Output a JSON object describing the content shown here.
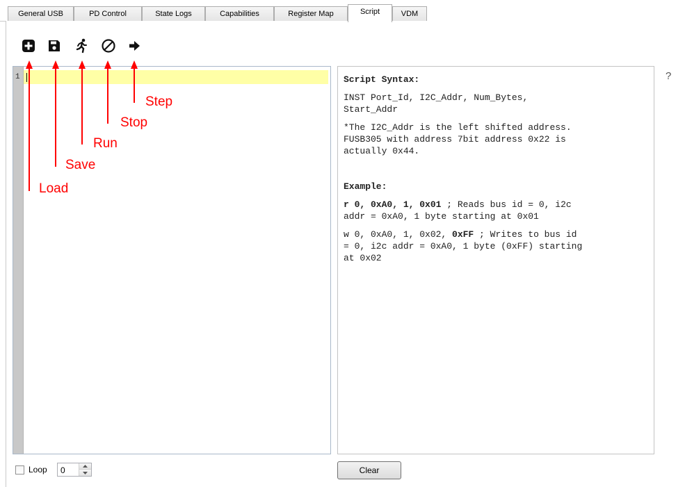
{
  "tabs": [
    {
      "label": "General USB",
      "active": false
    },
    {
      "label": "PD Control",
      "active": false
    },
    {
      "label": "State Logs",
      "active": false
    },
    {
      "label": "Capabilities",
      "active": false
    },
    {
      "label": "Register Map",
      "active": false
    },
    {
      "label": "Script",
      "active": true
    },
    {
      "label": "VDM",
      "active": false
    }
  ],
  "toolbar": {
    "icons": [
      "load-plus-icon",
      "save-floppy-icon",
      "run-figure-icon",
      "stop-circle-icon",
      "step-arrow-icon"
    ]
  },
  "editor": {
    "line_number": "1",
    "highlight_color": "#ffffa6"
  },
  "help": {
    "title": "Script Syntax:",
    "syntax": "INST Port_Id, I2C_Addr, Num_Bytes,\nStart_Addr",
    "note": "*The I2C_Addr is the left shifted address.\nFUSB305 with address 7bit address 0x22 is\nactually 0x44.",
    "example_title": "Example:",
    "example_read_cmd": "r 0, 0xA0, 1, 0x01",
    "example_read_desc": " ; Reads bus id = 0, i2c\naddr = 0xA0, 1 byte starting at 0x01",
    "example_write_cmd_start": "w 0, 0xA0, 1, 0x02, ",
    "example_write_cmd_bold": "0xFF",
    "example_write_desc": " ; Writes to bus id\n= 0, i2c addr = 0xA0, 1 byte (0xFF) starting\nat 0x02"
  },
  "help_button": "?",
  "bottom": {
    "loop_label": "Loop",
    "loop_checked": false,
    "loop_count": "0",
    "clear_label": "Clear"
  },
  "annotations": {
    "color": "#ff0000",
    "labels": {
      "load": "Load",
      "save": "Save",
      "run": "Run",
      "stop": "Stop",
      "step": "Step"
    }
  }
}
